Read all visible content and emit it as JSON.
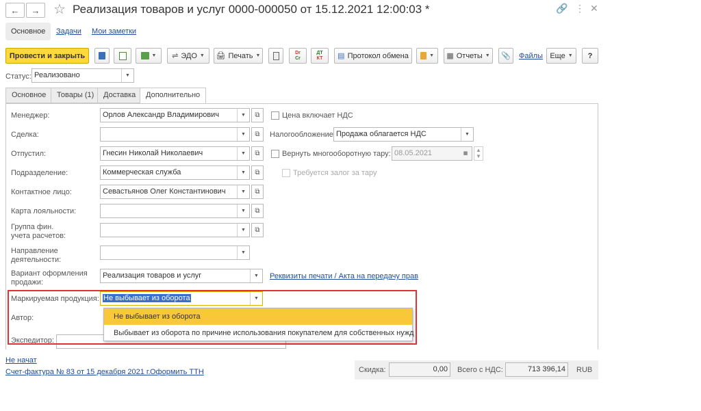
{
  "window": {
    "title": "Реализация товаров и услуг 0000-000050 от 15.12.2021 12:00:03 *"
  },
  "top_tabs": [
    "Основное",
    "Задачи",
    "Мои заметки"
  ],
  "toolbar": {
    "post_close": "Провести и закрыть",
    "edo": "ЭДО",
    "print": "Печать",
    "dt_label": "Dr",
    "dt_sub": "Cr",
    "kt_label": "ДТ",
    "kt_sub": "КТ",
    "exchange": "Протокол обмена",
    "reports": "Отчеты",
    "files": "Файлы",
    "more": "Еще",
    "help": "?"
  },
  "status": {
    "label": "Статус:",
    "value": "Реализовано"
  },
  "doc_tabs": [
    "Основное",
    "Товары (1)",
    "Доставка",
    "Дополнительно"
  ],
  "form": {
    "manager_label": "Менеджер:",
    "manager_value": "Орлов Александр Владимирович",
    "deal_label": "Сделка:",
    "deal_value": "",
    "released_label": "Отпустил:",
    "released_value": "Гнесин Николай Николаевич",
    "division_label": "Подразделение:",
    "division_value": "Коммерческая служба",
    "contact_label": "Контактное лицо:",
    "contact_value": "Севастьянов  Олег  Константинович",
    "loyalty_label": "Карта лояльности:",
    "fin_group_label_1": "Группа фин.",
    "fin_group_label_2": "учета расчетов:",
    "direction_label_1": "Направление",
    "direction_label_2": "деятельности:",
    "variant_label_1": "Вариант оформления",
    "variant_label_2": "продажи:",
    "variant_value": "Реализация товаров и услуг",
    "print_details_link": "Реквизиты печати / Акта на передачу прав",
    "marked_label": "Маркируемая продукция:",
    "marked_value": "Не выбывает из оборота",
    "author_label": "Автор:",
    "forwarder_label": "Экспедитор:",
    "vat_included_label": "Цена включает НДС",
    "taxation_label": "Налогообложение:",
    "taxation_value": "Продажа облагается НДС",
    "return_tare_label": "Вернуть многооборотную тару:",
    "return_tare_date": "08.05.2021",
    "deposit_label": "Требуется залог за тару"
  },
  "dropdown": {
    "options": [
      "Не выбывает из оборота",
      "Выбывает из оборота по причине использования покупателем для собственных нужд"
    ]
  },
  "footer": {
    "state_link": "Не начат",
    "invoice_link": "Счет-фактура № 83 от 15 декабря 2021 г.",
    "ttn_link": "Оформить ТТН",
    "discount_label": "Скидка:",
    "discount_value": "0,00",
    "total_label": "Всего с НДС:",
    "total_value": "713 396,14",
    "currency": "RUB"
  },
  "colors": {
    "accent_yellow": "#ffd83a",
    "selected_item": "#f9c838",
    "highlight_frame": "#e0322e",
    "link": "#1e4b9c"
  }
}
